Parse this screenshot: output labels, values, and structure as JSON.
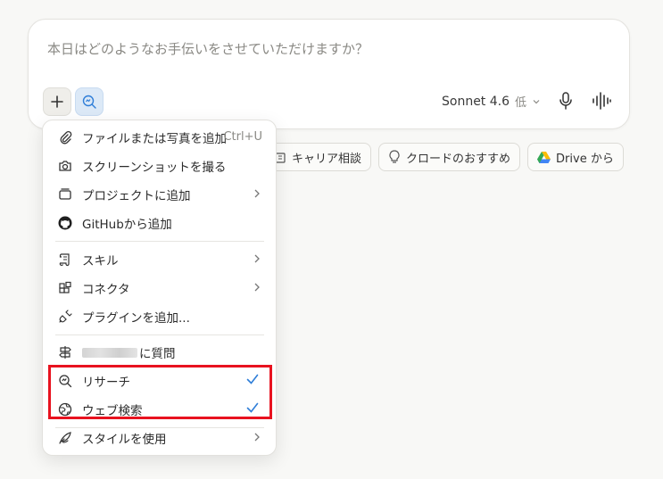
{
  "composer": {
    "placeholder": "本日はどのようなお手伝いをさせていただけますか？",
    "model_name": "Sonnet 4.6",
    "model_level": "低"
  },
  "chips": [
    {
      "label": "キャリア相談"
    },
    {
      "label": "クロードのおすすめ"
    },
    {
      "label": "Drive から"
    }
  ],
  "menu": {
    "add_file": "ファイルまたは写真を追加",
    "add_file_shortcut": "Ctrl+U",
    "screenshot": "スクリーンショットを撮る",
    "add_project": "プロジェクトに追加",
    "add_github": "GitHubから追加",
    "skills": "スキル",
    "connectors": "コネクタ",
    "add_plugin": "プラグインを追加...",
    "ask_suffix": "に質問",
    "research": "リサーチ",
    "web_search": "ウェブ検索",
    "use_style": "スタイルを使用"
  },
  "colors": {
    "accent": "#2f7ed8",
    "highlight": "#e8121f"
  }
}
